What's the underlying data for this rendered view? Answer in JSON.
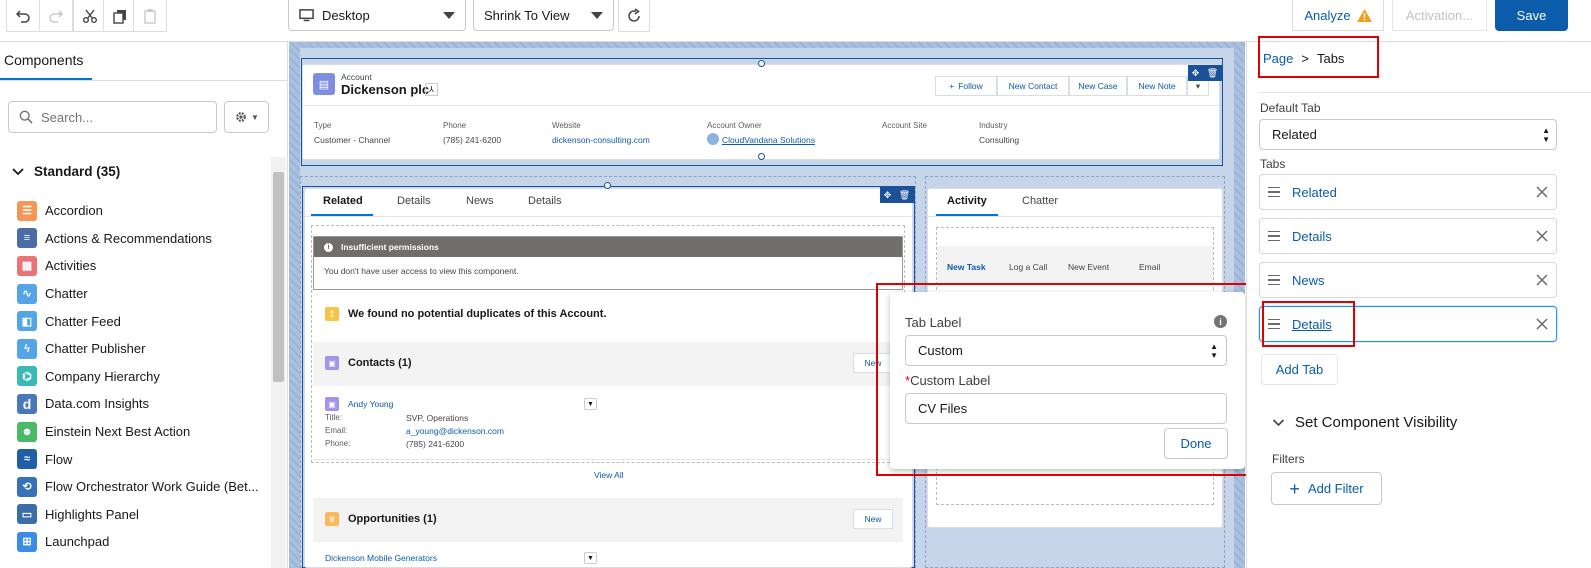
{
  "toolbar": {
    "device": "Desktop",
    "view": "Shrink To View",
    "analyze": "Analyze",
    "activation": "Activation...",
    "save": "Save"
  },
  "left": {
    "tab": "Components",
    "search_placeholder": "Search...",
    "section": "Standard (35)",
    "items": [
      {
        "label": "Accordion",
        "color": "#f49756"
      },
      {
        "label": "Actions & Recommendations",
        "color": "#4c6ca8"
      },
      {
        "label": "Activities",
        "color": "#e97379"
      },
      {
        "label": "Chatter",
        "color": "#54a4e8"
      },
      {
        "label": "Chatter Feed",
        "color": "#54a4e8"
      },
      {
        "label": "Chatter Publisher",
        "color": "#54a4e8"
      },
      {
        "label": "Company Hierarchy",
        "color": "#3ab9b5"
      },
      {
        "label": "Data.com Insights",
        "color": "#4a78b8"
      },
      {
        "label": "Einstein Next Best Action",
        "color": "#4bb86a"
      },
      {
        "label": "Flow",
        "color": "#1f5fa8"
      },
      {
        "label": "Flow Orchestrator Work Guide (Bet...",
        "color": "#3572b8"
      },
      {
        "label": "Highlights Panel",
        "color": "#3a6ea5"
      },
      {
        "label": "Launchpad",
        "color": "#3c8ce7"
      }
    ]
  },
  "canvas": {
    "record_type": "Account",
    "record_name": "Dickenson plc",
    "actions": [
      "Follow",
      "New Contact",
      "New Case",
      "New Note"
    ],
    "fields": [
      {
        "label": "Type",
        "value": "Customer - Channel"
      },
      {
        "label": "Phone",
        "value": "(785) 241-6200"
      },
      {
        "label": "Website",
        "value": "dickenson-consulting.com"
      },
      {
        "label": "Account Owner",
        "value": "CloudVandana Solutions"
      },
      {
        "label": "Account Site",
        "value": ""
      },
      {
        "label": "Industry",
        "value": "Consulting"
      }
    ],
    "tabs": [
      "Related",
      "Details",
      "News",
      "Details"
    ],
    "perm_title": "Insufficient permissions",
    "perm_text": "You don't have user access to view this component.",
    "dup_text": "We found no potential duplicates of this Account.",
    "contacts_title": "Contacts (1)",
    "new_label": "New",
    "contact": {
      "name": "Andy Young",
      "rows": [
        {
          "label": "Title:",
          "value": "SVP, Operations"
        },
        {
          "label": "Email:",
          "value": "a_young@dickenson.com"
        },
        {
          "label": "Phone:",
          "value": "(785) 241-6200"
        }
      ]
    },
    "view_all": "View All",
    "opps_title": "Opportunities (1)",
    "opp_name": "Dickenson Mobile Generators",
    "activity_tabs": [
      "Activity",
      "Chatter"
    ],
    "activity_actions": [
      "New Task",
      "Log a Call",
      "New Event",
      "Email"
    ]
  },
  "popover": {
    "tab_label": "Tab Label",
    "tab_label_value": "Custom",
    "custom_label": "Custom Label",
    "required": "*",
    "custom_value": "CV Files",
    "done": "Done"
  },
  "right": {
    "breadcrumb_page": "Page",
    "breadcrumb_sep": ">",
    "breadcrumb_current": "Tabs",
    "default_tab_label": "Default Tab",
    "default_tab_value": "Related",
    "tabs_label": "Tabs",
    "tabs": [
      "Related",
      "Details",
      "News",
      "Details"
    ],
    "add_tab": "Add Tab",
    "visibility": "Set Component Visibility",
    "filters": "Filters",
    "add_filter": "Add Filter"
  }
}
